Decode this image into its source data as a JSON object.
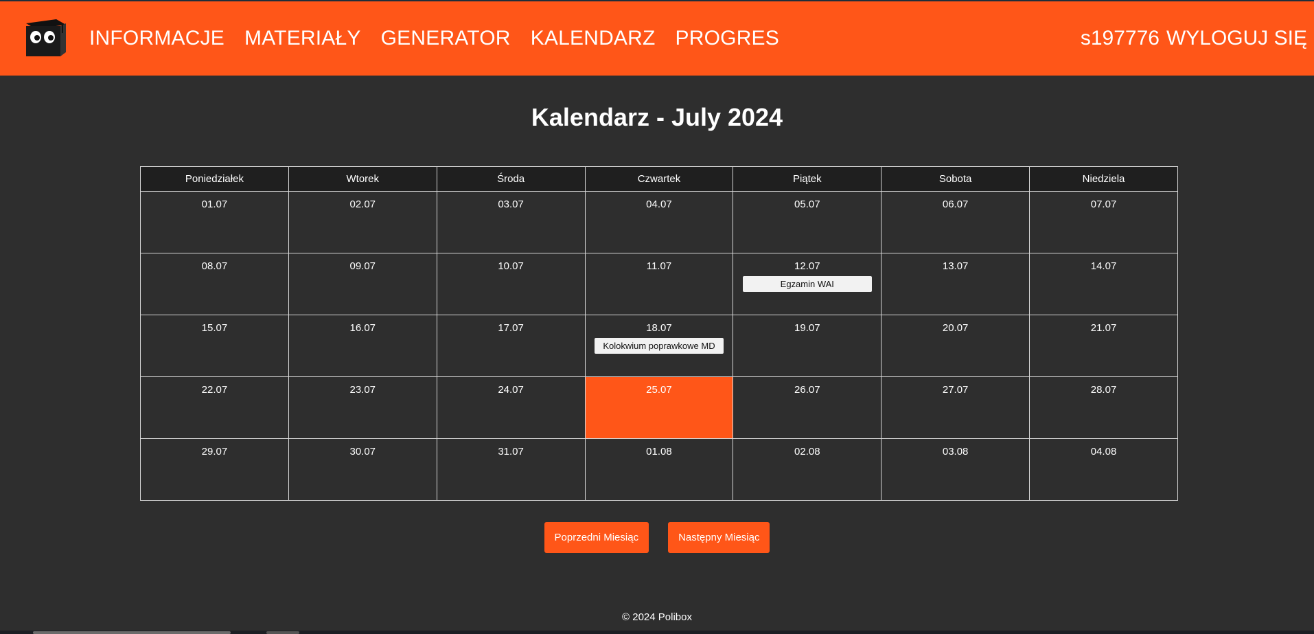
{
  "header": {
    "nav": [
      "INFORMACJE",
      "MATERIAŁY",
      "GENERATOR",
      "KALENDARZ",
      "PROGRES"
    ],
    "username": "s197776",
    "logout_label": "WYLOGUJ SIĘ",
    "accent_color": "#ff5618"
  },
  "main": {
    "title": "Kalendarz - July 2024",
    "weekdays": [
      "Poniedziałek",
      "Wtorek",
      "Środa",
      "Czwartek",
      "Piątek",
      "Sobota",
      "Niedziela"
    ],
    "weeks": [
      [
        "01.07",
        "02.07",
        "03.07",
        "04.07",
        "05.07",
        "06.07",
        "07.07"
      ],
      [
        "08.07",
        "09.07",
        "10.07",
        "11.07",
        "12.07",
        "13.07",
        "14.07"
      ],
      [
        "15.07",
        "16.07",
        "17.07",
        "18.07",
        "19.07",
        "20.07",
        "21.07"
      ],
      [
        "22.07",
        "23.07",
        "24.07",
        "25.07",
        "26.07",
        "27.07",
        "28.07"
      ],
      [
        "29.07",
        "30.07",
        "31.07",
        "01.08",
        "02.08",
        "03.08",
        "04.08"
      ]
    ],
    "events": {
      "wed": "Egzamin WAI",
      "thu": "Kolokwium poprawkowe MD"
    },
    "today_date": "25.07",
    "prev_month_label": "Poprzedni Miesiąc",
    "next_month_label": "Następny Miesiąc"
  },
  "footer": {
    "text": "© 2024 Polibox"
  }
}
